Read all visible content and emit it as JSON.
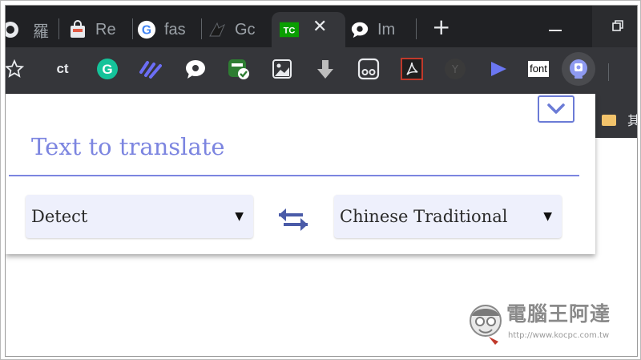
{
  "browser": {
    "tabs": [
      {
        "label": "羅",
        "icon": "globe-icon"
      },
      {
        "label": "Re",
        "icon": "bag-icon"
      },
      {
        "label": "fas",
        "icon": "google-icon"
      },
      {
        "label": "Gc",
        "icon": "feather-icon"
      },
      {
        "label": "",
        "icon": "tc-icon",
        "icon_text": "TC",
        "active": true
      },
      {
        "label": "Im",
        "icon": "chat-bubble-icon"
      }
    ],
    "close_glyph": "✕",
    "new_tab_glyph": "+",
    "toolbar_text": {
      "ct": "ct",
      "grammarly": "G",
      "font": "font"
    },
    "bookmark_text": "其"
  },
  "popup": {
    "placeholder": "Text to translate",
    "source_language": "Detect",
    "target_language": "Chinese Traditional",
    "caret": "▼"
  },
  "watermark": {
    "title": "電腦王阿達",
    "url": "http://www.kocpc.com.tw"
  },
  "colors": {
    "accent": "#7c85e0",
    "select_bg": "#eef0fc",
    "chrome_dark": "#202124",
    "chrome_toolbar": "#35363a"
  }
}
